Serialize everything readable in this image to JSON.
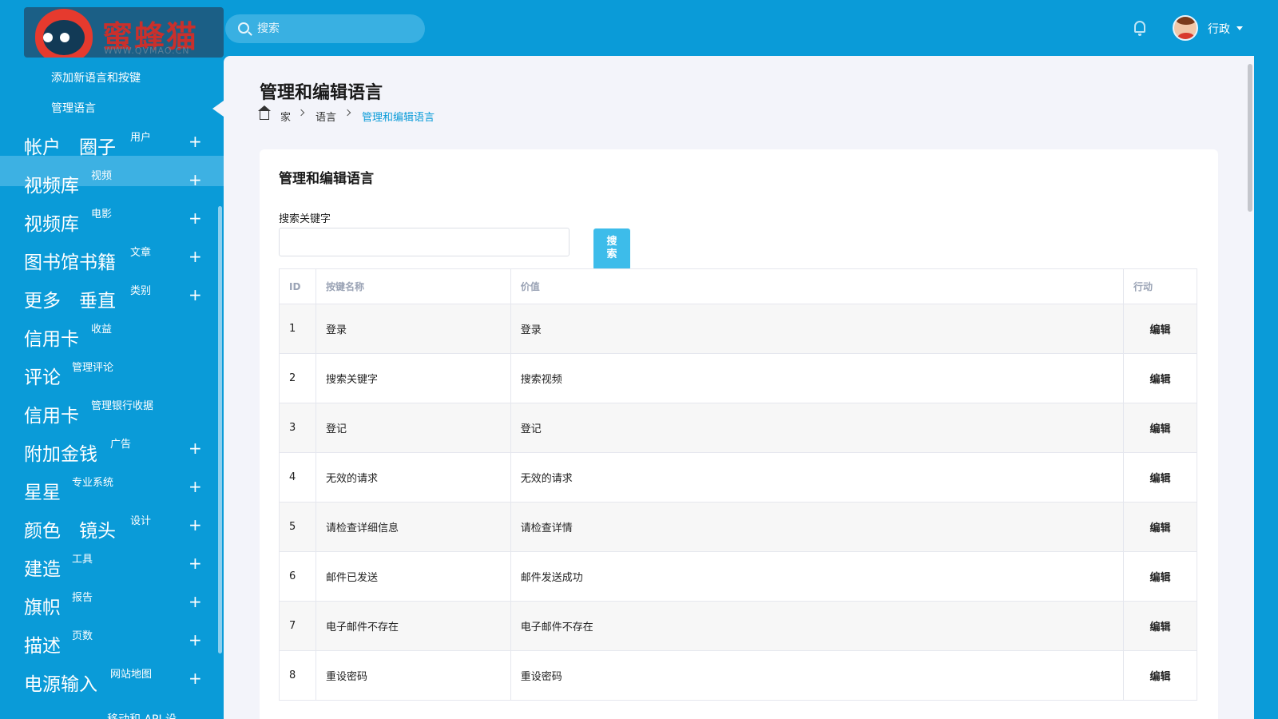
{
  "brand": {
    "logo_text": "蜜蜂猫",
    "logo_sub": "WWW.QVMAO.CN"
  },
  "header": {
    "search_placeholder": "搜索",
    "user_name": "行政"
  },
  "sidebar": {
    "sub_items": [
      "添加新语言和按键",
      "管理语言"
    ],
    "items": [
      {
        "main": "帐户　圈子",
        "sub": "用户",
        "plus": "+"
      },
      {
        "main": "视频库",
        "sub": "视频",
        "plus": "+"
      },
      {
        "main": "视频库",
        "sub": "电影",
        "plus": "+"
      },
      {
        "main": "图书馆书籍",
        "sub": "文章",
        "plus": "+"
      },
      {
        "main": "更多　垂直",
        "sub": "类别",
        "plus": "+"
      },
      {
        "main": "信用卡",
        "sub": "收益",
        "plus": ""
      },
      {
        "main": "评论",
        "sub": "管理评论",
        "plus": ""
      },
      {
        "main": "信用卡",
        "sub": "管理银行收据",
        "plus": ""
      },
      {
        "main": "附加金钱",
        "sub": "广告",
        "plus": "+"
      },
      {
        "main": "星星",
        "sub": "专业系统",
        "plus": "+"
      },
      {
        "main": "颜色　镜头",
        "sub": "设计",
        "plus": "+"
      },
      {
        "main": "建造",
        "sub": "工具",
        "plus": "+"
      },
      {
        "main": "旗帜",
        "sub": "报告",
        "plus": "+"
      },
      {
        "main": "描述",
        "sub": "页数",
        "plus": "+"
      },
      {
        "main": "电源输入",
        "sub": "网站地图",
        "plus": "+"
      }
    ],
    "bottom_item": "移动和 API 设"
  },
  "page": {
    "title": "管理和编辑语言",
    "breadcrumb": [
      "家",
      "语言",
      "管理和编辑语言"
    ]
  },
  "card": {
    "title": "管理和编辑语言",
    "keyword_label": "搜索关键字",
    "search_button": "搜\n索"
  },
  "table": {
    "headers": [
      "ID",
      "按键名称",
      "价值",
      "行动"
    ],
    "rows": [
      {
        "id": "1",
        "key": "登录",
        "value": "登录",
        "action": "编辑"
      },
      {
        "id": "2",
        "key": "搜索关键字",
        "value": "搜索视频",
        "action": "编辑"
      },
      {
        "id": "3",
        "key": "登记",
        "value": "登记",
        "action": "编辑"
      },
      {
        "id": "4",
        "key": "无效的请求",
        "value": "无效的请求",
        "action": "编辑"
      },
      {
        "id": "5",
        "key": "请检查详细信息",
        "value": "请检查详情",
        "action": "编辑"
      },
      {
        "id": "6",
        "key": "邮件已发送",
        "value": "邮件发送成功",
        "action": "编辑"
      },
      {
        "id": "7",
        "key": "电子邮件不存在",
        "value": "电子邮件不存在",
        "action": "编辑"
      },
      {
        "id": "8",
        "key": "重设密码",
        "value": "重设密码",
        "action": "编辑"
      }
    ]
  },
  "colors": {
    "primary": "#0a9bd8",
    "sub_active": "#3db1e3",
    "button": "#3dbcea",
    "link": "#0a9bd8",
    "content_bg": "#f3f4fa"
  }
}
